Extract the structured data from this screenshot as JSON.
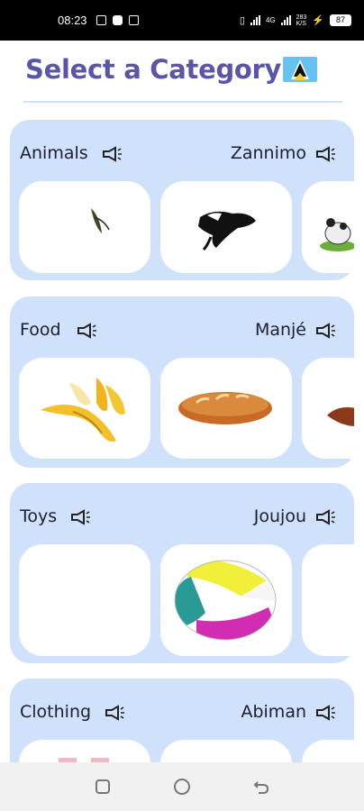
{
  "status_bar": {
    "time": "08:23",
    "network_small": "4G",
    "speed_top": "283",
    "speed_unit": "K/S",
    "battery": "87"
  },
  "header": {
    "title": "Select a Category"
  },
  "categories": [
    {
      "english": "Animals",
      "kweyol": "Zannimo"
    },
    {
      "english": "Food",
      "kweyol": "Manjé"
    },
    {
      "english": "Toys",
      "kweyol": "Joujou"
    },
    {
      "english": "Clothing",
      "kweyol": "Abiman"
    }
  ],
  "icons": {
    "speaker": "megaphone-icon",
    "flag": "saint-lucia-flag-icon",
    "nav_recents": "square-icon",
    "nav_home": "circle-icon",
    "nav_back": "back-arrow-icon"
  },
  "colors": {
    "title": "#5b55a8",
    "card_bg": "#cfe1fb",
    "tile_bg": "#ffffff"
  }
}
